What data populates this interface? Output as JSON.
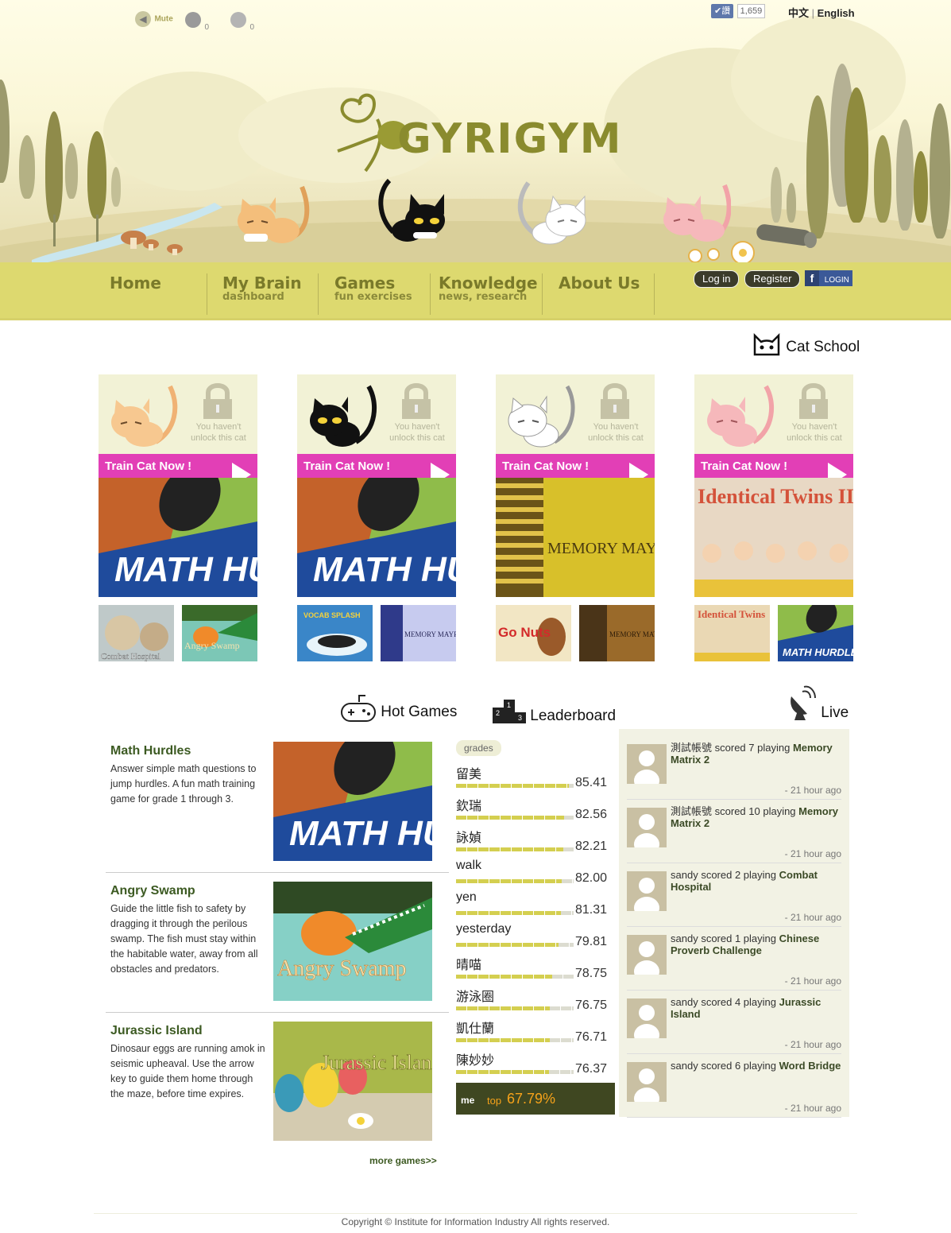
{
  "topbar": {
    "mute_label": "Mute",
    "counter1": "0",
    "counter2": "0",
    "fb_like_count": "1,659",
    "fb_like_label": "讚",
    "lang_zh": "中文",
    "lang_sep": "|",
    "lang_en": "English"
  },
  "brand": {
    "logo_text": "GYRIGYM"
  },
  "nav": {
    "items": [
      {
        "title": "Home",
        "sub": ""
      },
      {
        "title": "My Brain",
        "sub": "dashboard"
      },
      {
        "title": "Games",
        "sub": "fun exercises"
      },
      {
        "title": "Knowledge",
        "sub": "news, research"
      },
      {
        "title": "About Us",
        "sub": ""
      }
    ],
    "login": "Log in",
    "register": "Register",
    "fb_login": "LOGIN",
    "fb_letter": "f"
  },
  "cat_school": {
    "title": "Cat School",
    "lock_text_1": "You haven't",
    "lock_text_2": "unlock this cat",
    "train_label": "Train Cat Now !",
    "cards": [
      {
        "cat": "orange-cat",
        "game": "MATH HURDLES",
        "thumbs": [
          "Combat Hospital",
          "Angry Swamp"
        ]
      },
      {
        "cat": "black-cat",
        "game": "MATH HURDLES",
        "thumbs": [
          "VOCAB SPLASH",
          "MEMORY MAYRIX III"
        ]
      },
      {
        "cat": "white-cat",
        "game": "MEMORY MAYRIX II",
        "thumbs": [
          "Go Nuts",
          "MEMORY MATRIX"
        ]
      },
      {
        "cat": "pink-cat",
        "game": "Identical Twins II",
        "thumbs": [
          "Identical Twins",
          "MATH HURDLES"
        ]
      }
    ]
  },
  "hot_games": {
    "title": "Hot Games",
    "items": [
      {
        "name": "Math Hurdles",
        "desc": "Answer simple math questions to jump hurdles. A fun math training game for grade 1 through 3."
      },
      {
        "name": "Angry Swamp",
        "desc": "Guide the little fish to safety by dragging it through the perilous swamp. The fish must stay within the habitable water, away from all obstacles and predators."
      },
      {
        "name": "Jurassic Island",
        "desc": "Dinosaur eggs are running amok in seismic upheaval. Use the arrow key to guide them home through the maze, before time expires."
      }
    ],
    "more": "more games>>"
  },
  "leaderboard": {
    "title": "Leaderboard",
    "icon_digits": [
      "1",
      "2",
      "3"
    ],
    "tab": "grades",
    "rows": [
      {
        "name": "留美",
        "score": "85.41",
        "fill": 0.96
      },
      {
        "name": "欽瑞",
        "score": "82.56",
        "fill": 0.92
      },
      {
        "name": "詠媜",
        "score": "82.21",
        "fill": 0.91
      },
      {
        "name": "walk",
        "score": "82.00",
        "fill": 0.9
      },
      {
        "name": "yen",
        "score": "81.31",
        "fill": 0.89
      },
      {
        "name": "yesterday",
        "score": "79.81",
        "fill": 0.87
      },
      {
        "name": "晴喵",
        "score": "78.75",
        "fill": 0.82
      },
      {
        "name": "游泳圈",
        "score": "76.75",
        "fill": 0.8
      },
      {
        "name": "凱仕蘭",
        "score": "76.71",
        "fill": 0.8
      },
      {
        "name": "陳妙妙",
        "score": "76.37",
        "fill": 0.79
      }
    ],
    "me_label": "me",
    "top_label": "top",
    "me_percent": "67.79%"
  },
  "live": {
    "title": "Live",
    "items": [
      {
        "user": "測試帳號",
        "scored": "scored 7 playing",
        "game": "Memory Matrix 2",
        "time": "- 21 hour ago"
      },
      {
        "user": "測試帳號",
        "scored": "scored 10 playing",
        "game": "Memory Matrix 2",
        "time": "- 21 hour ago"
      },
      {
        "user": "sandy",
        "scored": "scored 2 playing",
        "game": "Combat Hospital",
        "time": "- 21 hour ago"
      },
      {
        "user": "sandy",
        "scored": "scored 1 playing",
        "game": "Chinese Proverb Challenge",
        "time": "- 21 hour ago"
      },
      {
        "user": "sandy",
        "scored": "scored 4 playing",
        "game": "Jurassic Island",
        "time": "- 21 hour ago"
      },
      {
        "user": "sandy",
        "scored": "scored 6 playing",
        "game": "Word Bridge",
        "time": "- 21 hour ago"
      }
    ]
  },
  "footer": {
    "copyright": "Copyright © Institute for Information Industry All rights reserved."
  },
  "colors": {
    "nav_bg": "#ddd96f",
    "accent_pink": "#e23fb6",
    "brand_olive": "#8a8b2e",
    "me_bar": "#3f4721",
    "highlight_orange": "#f6a21a"
  }
}
